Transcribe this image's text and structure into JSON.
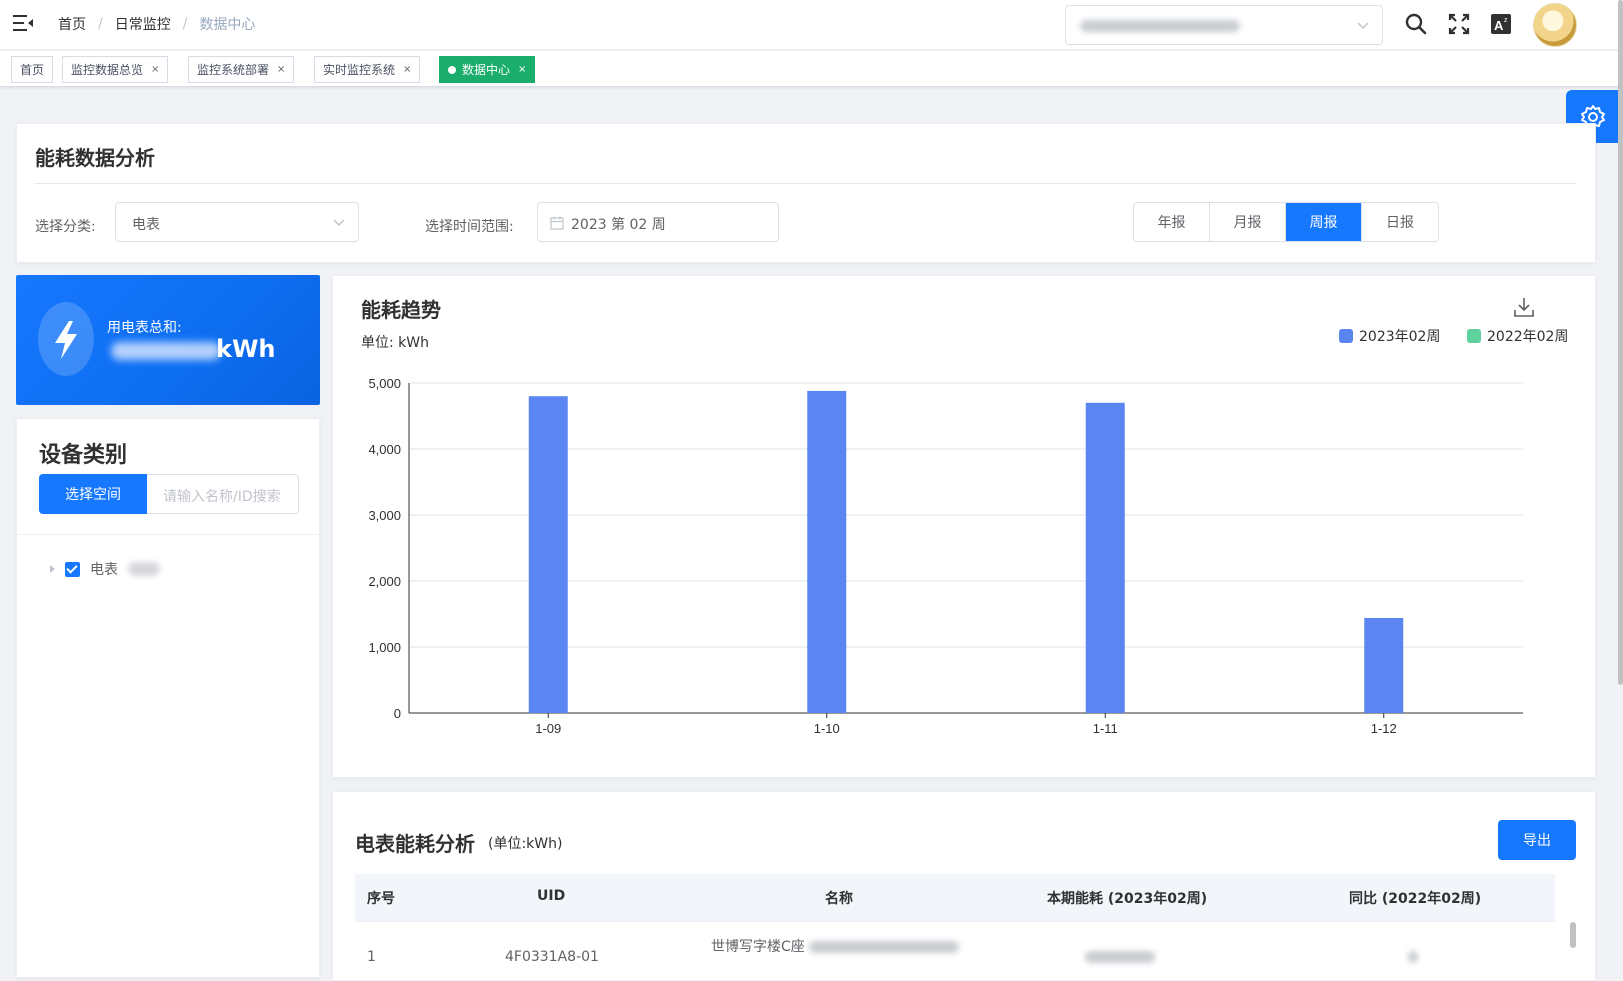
{
  "breadcrumb": [
    "首页",
    "日常监控",
    "数据中心"
  ],
  "tags": [
    {
      "label": "首页",
      "closable": false,
      "active": false
    },
    {
      "label": "监控数据总览",
      "closable": true,
      "active": false
    },
    {
      "label": "监控系统部署",
      "closable": true,
      "active": false
    },
    {
      "label": "实时监控系统",
      "closable": true,
      "active": false
    },
    {
      "label": "数据中心",
      "closable": true,
      "active": true
    }
  ],
  "tag_close_glyph": "×",
  "icons": {
    "menu": "hamburger-menu-icon",
    "search": "search-icon",
    "fullscreen": "fullscreen-icon",
    "translate": "translate-icon",
    "settings": "gear-icon",
    "download": "download-icon",
    "bolt": "lightning-bolt-icon"
  },
  "filter": {
    "title": "能耗数据分析",
    "category_label": "选择分类:",
    "category_value": "电表",
    "time_label": "选择时间范围:",
    "time_value": "2023 第 02 周",
    "period_buttons": [
      "年报",
      "月报",
      "周报",
      "日报"
    ],
    "active_period": "周报"
  },
  "total": {
    "label": "用电表总和:",
    "unit": "kWh"
  },
  "device": {
    "title": "设备类别",
    "select_space_button": "选择空间",
    "search_placeholder": "请输入名称/ID搜索",
    "tree_item": "电表"
  },
  "chart": {
    "title": "能耗趋势",
    "unit_label": "单位:   kWh"
  },
  "chart_data": {
    "type": "bar",
    "categories": [
      "1-09",
      "1-10",
      "1-11",
      "1-12"
    ],
    "series": [
      {
        "name": "2023年02周",
        "color": "#5b86f2",
        "values": [
          4800,
          4880,
          4700,
          1440
        ]
      },
      {
        "name": "2022年02周",
        "color": "#5ed3a0",
        "values": [
          0,
          0,
          0,
          0
        ]
      }
    ],
    "ylim": [
      0,
      5000
    ],
    "yticks": [
      "0",
      "1,000",
      "2,000",
      "3,000",
      "4,000",
      "5,000"
    ],
    "ytick_values": [
      0,
      1000,
      2000,
      3000,
      4000,
      5000
    ],
    "grid": true,
    "legend": "top-right"
  },
  "table": {
    "title": "电表能耗分析",
    "subtitle": "(单位:kWh)",
    "export_button": "导出",
    "columns": [
      "序号",
      "UID",
      "名称",
      "本期能耗 (2023年02周)",
      "同比 (2022年02周)"
    ],
    "rows": [
      {
        "index": "1",
        "uid": "4F0331A8-01",
        "name": "世博写字楼C座"
      }
    ]
  },
  "colors": {
    "primary": "#1677ff",
    "active_tag": "#1aad6b",
    "bar_2023": "#5b86f2",
    "bar_2022": "#5ed3a0"
  }
}
